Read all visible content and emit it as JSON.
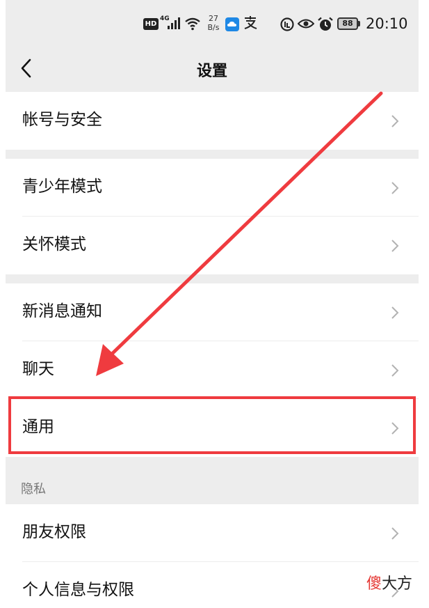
{
  "status_bar": {
    "hd": "HD",
    "network": "4G",
    "speed_value": "27",
    "speed_unit": "B/s",
    "battery": "88",
    "time": "20:10"
  },
  "nav": {
    "title": "设置"
  },
  "groups": [
    {
      "items": [
        "帐号与安全"
      ]
    },
    {
      "items": [
        "青少年模式",
        "关怀模式"
      ]
    },
    {
      "items": [
        "新消息通知",
        "聊天",
        "通用"
      ]
    },
    {
      "items": [
        "朋友权限",
        "个人信息与权限"
      ]
    }
  ],
  "section_privacy": "隐私",
  "watermark": {
    "first": "傻",
    "rest": "大方"
  },
  "colors": {
    "background": "#ededed",
    "highlight": "#ef3b3f",
    "arrow": "#ef3b3f"
  }
}
